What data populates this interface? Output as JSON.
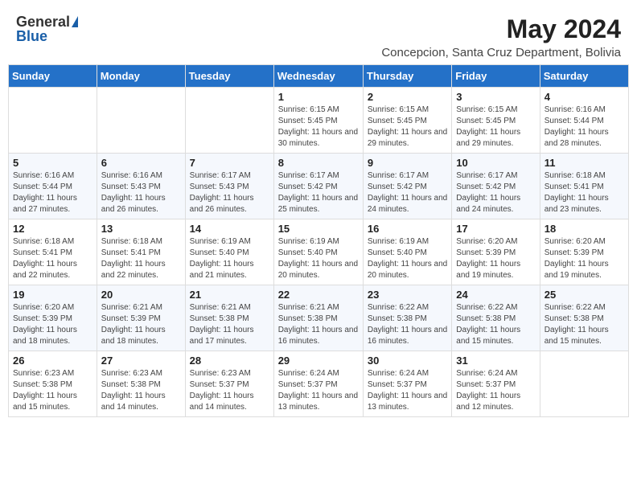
{
  "header": {
    "logo_general": "General",
    "logo_blue": "Blue",
    "main_title": "May 2024",
    "subtitle": "Concepcion, Santa Cruz Department, Bolivia"
  },
  "days_of_week": [
    "Sunday",
    "Monday",
    "Tuesday",
    "Wednesday",
    "Thursday",
    "Friday",
    "Saturday"
  ],
  "weeks": [
    [
      {
        "day": "",
        "info": ""
      },
      {
        "day": "",
        "info": ""
      },
      {
        "day": "",
        "info": ""
      },
      {
        "day": "1",
        "info": "Sunrise: 6:15 AM\nSunset: 5:45 PM\nDaylight: 11 hours\nand 30 minutes."
      },
      {
        "day": "2",
        "info": "Sunrise: 6:15 AM\nSunset: 5:45 PM\nDaylight: 11 hours\nand 29 minutes."
      },
      {
        "day": "3",
        "info": "Sunrise: 6:15 AM\nSunset: 5:45 PM\nDaylight: 11 hours\nand 29 minutes."
      },
      {
        "day": "4",
        "info": "Sunrise: 6:16 AM\nSunset: 5:44 PM\nDaylight: 11 hours\nand 28 minutes."
      }
    ],
    [
      {
        "day": "5",
        "info": "Sunrise: 6:16 AM\nSunset: 5:44 PM\nDaylight: 11 hours\nand 27 minutes."
      },
      {
        "day": "6",
        "info": "Sunrise: 6:16 AM\nSunset: 5:43 PM\nDaylight: 11 hours\nand 26 minutes."
      },
      {
        "day": "7",
        "info": "Sunrise: 6:17 AM\nSunset: 5:43 PM\nDaylight: 11 hours\nand 26 minutes."
      },
      {
        "day": "8",
        "info": "Sunrise: 6:17 AM\nSunset: 5:42 PM\nDaylight: 11 hours\nand 25 minutes."
      },
      {
        "day": "9",
        "info": "Sunrise: 6:17 AM\nSunset: 5:42 PM\nDaylight: 11 hours\nand 24 minutes."
      },
      {
        "day": "10",
        "info": "Sunrise: 6:17 AM\nSunset: 5:42 PM\nDaylight: 11 hours\nand 24 minutes."
      },
      {
        "day": "11",
        "info": "Sunrise: 6:18 AM\nSunset: 5:41 PM\nDaylight: 11 hours\nand 23 minutes."
      }
    ],
    [
      {
        "day": "12",
        "info": "Sunrise: 6:18 AM\nSunset: 5:41 PM\nDaylight: 11 hours\nand 22 minutes."
      },
      {
        "day": "13",
        "info": "Sunrise: 6:18 AM\nSunset: 5:41 PM\nDaylight: 11 hours\nand 22 minutes."
      },
      {
        "day": "14",
        "info": "Sunrise: 6:19 AM\nSunset: 5:40 PM\nDaylight: 11 hours\nand 21 minutes."
      },
      {
        "day": "15",
        "info": "Sunrise: 6:19 AM\nSunset: 5:40 PM\nDaylight: 11 hours\nand 20 minutes."
      },
      {
        "day": "16",
        "info": "Sunrise: 6:19 AM\nSunset: 5:40 PM\nDaylight: 11 hours\nand 20 minutes."
      },
      {
        "day": "17",
        "info": "Sunrise: 6:20 AM\nSunset: 5:39 PM\nDaylight: 11 hours\nand 19 minutes."
      },
      {
        "day": "18",
        "info": "Sunrise: 6:20 AM\nSunset: 5:39 PM\nDaylight: 11 hours\nand 19 minutes."
      }
    ],
    [
      {
        "day": "19",
        "info": "Sunrise: 6:20 AM\nSunset: 5:39 PM\nDaylight: 11 hours\nand 18 minutes."
      },
      {
        "day": "20",
        "info": "Sunrise: 6:21 AM\nSunset: 5:39 PM\nDaylight: 11 hours\nand 18 minutes."
      },
      {
        "day": "21",
        "info": "Sunrise: 6:21 AM\nSunset: 5:38 PM\nDaylight: 11 hours\nand 17 minutes."
      },
      {
        "day": "22",
        "info": "Sunrise: 6:21 AM\nSunset: 5:38 PM\nDaylight: 11 hours\nand 16 minutes."
      },
      {
        "day": "23",
        "info": "Sunrise: 6:22 AM\nSunset: 5:38 PM\nDaylight: 11 hours\nand 16 minutes."
      },
      {
        "day": "24",
        "info": "Sunrise: 6:22 AM\nSunset: 5:38 PM\nDaylight: 11 hours\nand 15 minutes."
      },
      {
        "day": "25",
        "info": "Sunrise: 6:22 AM\nSunset: 5:38 PM\nDaylight: 11 hours\nand 15 minutes."
      }
    ],
    [
      {
        "day": "26",
        "info": "Sunrise: 6:23 AM\nSunset: 5:38 PM\nDaylight: 11 hours\nand 15 minutes."
      },
      {
        "day": "27",
        "info": "Sunrise: 6:23 AM\nSunset: 5:38 PM\nDaylight: 11 hours\nand 14 minutes."
      },
      {
        "day": "28",
        "info": "Sunrise: 6:23 AM\nSunset: 5:37 PM\nDaylight: 11 hours\nand 14 minutes."
      },
      {
        "day": "29",
        "info": "Sunrise: 6:24 AM\nSunset: 5:37 PM\nDaylight: 11 hours\nand 13 minutes."
      },
      {
        "day": "30",
        "info": "Sunrise: 6:24 AM\nSunset: 5:37 PM\nDaylight: 11 hours\nand 13 minutes."
      },
      {
        "day": "31",
        "info": "Sunrise: 6:24 AM\nSunset: 5:37 PM\nDaylight: 11 hours\nand 12 minutes."
      },
      {
        "day": "",
        "info": ""
      }
    ]
  ]
}
